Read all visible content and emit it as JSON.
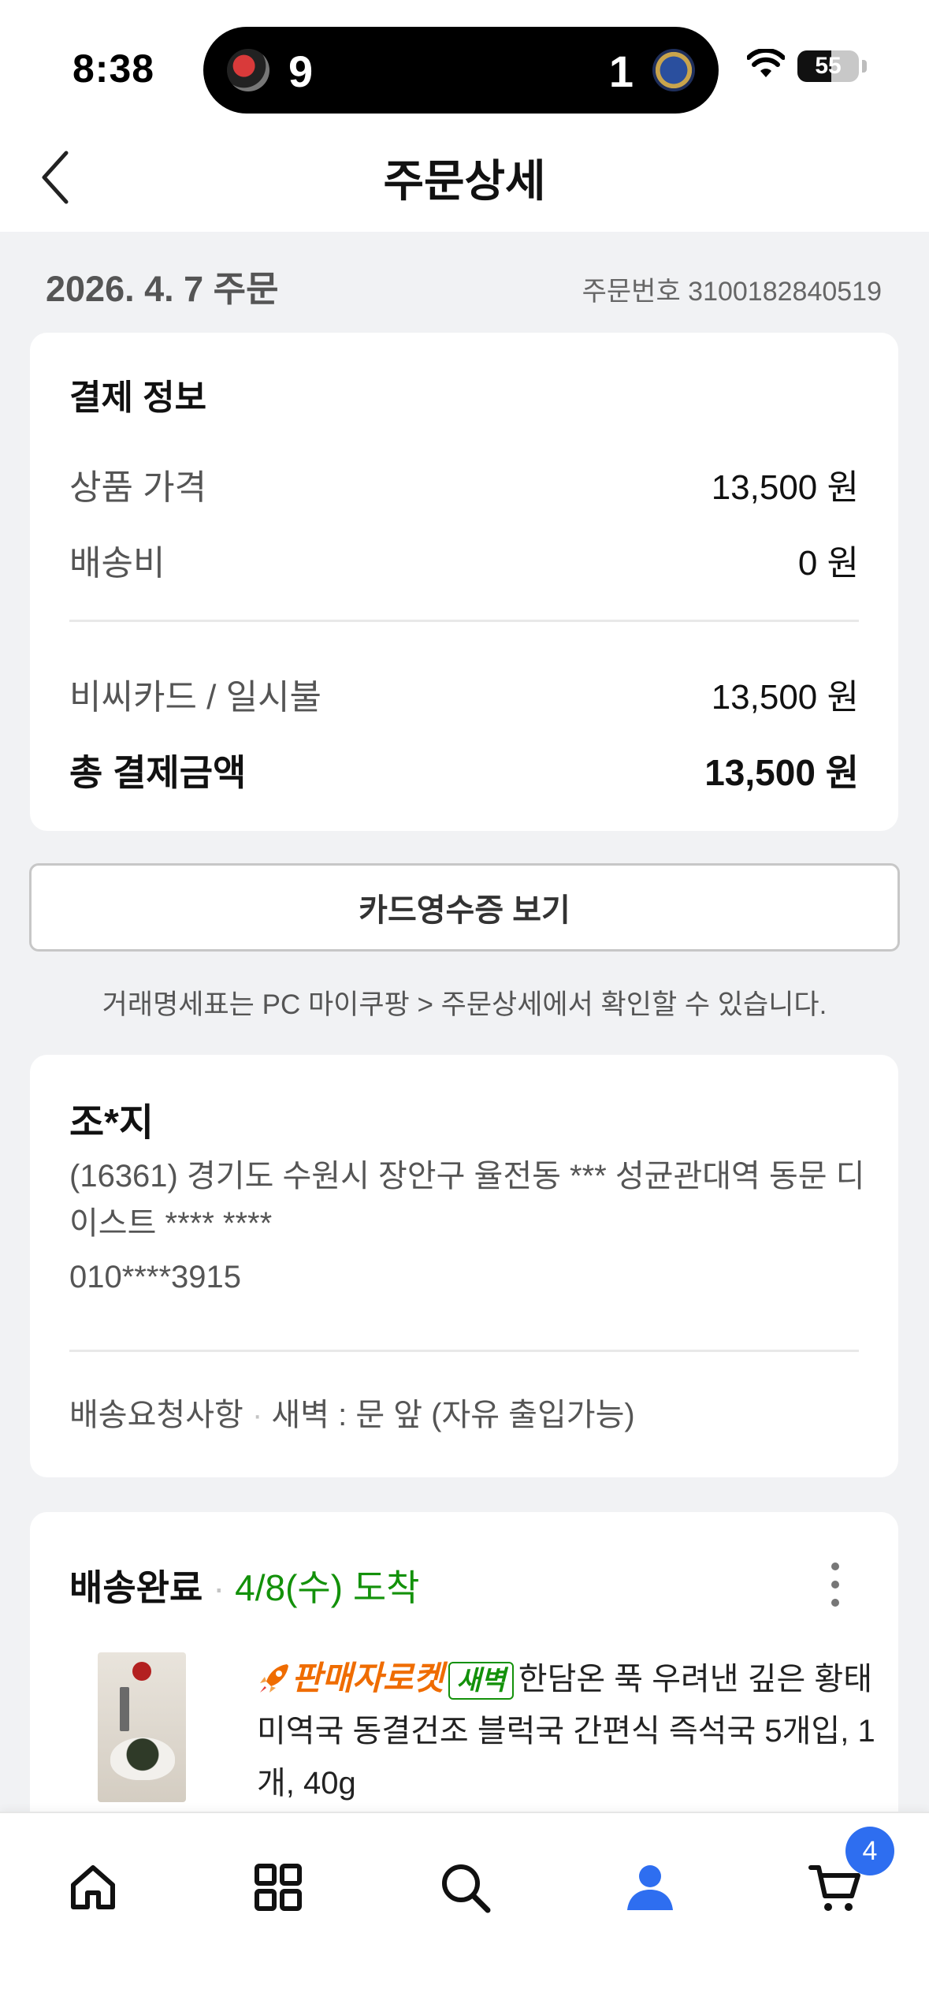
{
  "status_bar": {
    "time": "8:38",
    "live_activity": {
      "score_left": "9",
      "score_right": "1"
    },
    "battery": "55",
    "battery_level_percent": 55
  },
  "header": {
    "title": "주문상세"
  },
  "order": {
    "date": "2026. 4. 7 주문",
    "number": "주문번호 3100182840519"
  },
  "payment": {
    "title": "결제 정보",
    "rows": [
      {
        "label": "상품 가격",
        "value": "13,500 원"
      },
      {
        "label": "배송비",
        "value": "0 원"
      }
    ],
    "method": {
      "label": "비씨카드 / 일시불",
      "value": "13,500 원"
    },
    "total": {
      "label": "총 결제금액",
      "value": "13,500 원"
    }
  },
  "receipt_button": "카드영수증 보기",
  "notice": "거래명세표는 PC 마이쿠팡 > 주문상세에서 확인할 수 있습니다.",
  "shipping": {
    "recipient": "조*지",
    "address": "(16361) 경기도 수원시 장안구 율전동 *** 성균관대역 동문 디 이스트 **** ****",
    "phone": "010****3915",
    "request_label": "배송요청사항",
    "request_value": "새벽 : 문 앞 (자유 출입가능)"
  },
  "delivery": {
    "status": "배송완료",
    "arrival": "4/8(수) 도착",
    "seller_rocket_label": "판매자로켓",
    "dawn_badge": "새벽",
    "product_name": "한담온 푹 우려낸 깊은 황태 미역국 동결건조 블럭국 간편식 즉석국 5개입, 1개, 40g"
  },
  "bottom_nav": {
    "items": [
      "home-icon",
      "category-icon",
      "search-icon",
      "my-page-icon",
      "cart-icon"
    ],
    "active": "my-page-icon",
    "cart_count": "4"
  },
  "colors": {
    "accent_blue": "#2e6ef0",
    "arrival_green": "#13910a",
    "rocket_orange": "#ef6c00"
  }
}
